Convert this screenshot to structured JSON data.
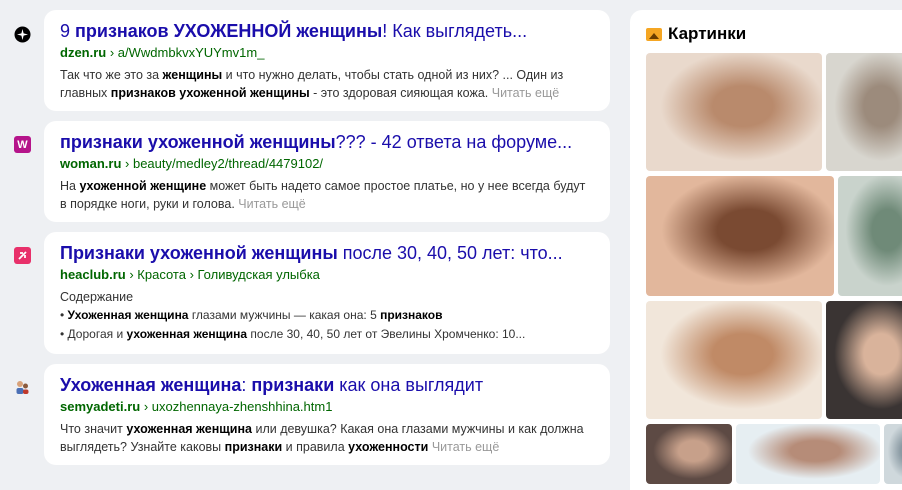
{
  "results": [
    {
      "title_parts": [
        {
          "t": "9 ",
          "b": false
        },
        {
          "t": "признаков УХОЖЕННОЙ женщины",
          "b": true
        },
        {
          "t": "! Как выглядеть...",
          "b": false
        }
      ],
      "domain": "dzen.ru",
      "path": " › a/WwdmbkvxYUYmv1m_",
      "snippet_parts": [
        {
          "t": "Так что же это за ",
          "b": false
        },
        {
          "t": "женщины",
          "b": true
        },
        {
          "t": " и что нужно делать, чтобы стать одной из них? ... Один из главных ",
          "b": false
        },
        {
          "t": "признаков ухоженной женщины",
          "b": true
        },
        {
          "t": " - это здоровая сияющая кожа. ",
          "b": false
        }
      ],
      "more": "Читать ещё",
      "favicon_icon": "dzen-icon",
      "favicon_color": "#000000"
    },
    {
      "title_parts": [
        {
          "t": "признаки ухоженной женщины",
          "b": true
        },
        {
          "t": "??? - 42 ответа на форуме...",
          "b": false
        }
      ],
      "domain": "woman.ru",
      "path": " › beauty/medley2/thread/4479102/",
      "snippet_parts": [
        {
          "t": "На ",
          "b": false
        },
        {
          "t": "ухоженной женщине",
          "b": true
        },
        {
          "t": " может быть надето самое простое платье, но у нее всегда будут в порядке ноги, руки и голова. ",
          "b": false
        }
      ],
      "more": "Читать ещё",
      "favicon_icon": "woman-icon",
      "favicon_letter": "W",
      "favicon_color": "#b5148a"
    },
    {
      "title_parts": [
        {
          "t": "Признаки ухоженной женщины",
          "b": true
        },
        {
          "t": " после 30, 40, 50 лет: что...",
          "b": false
        }
      ],
      "domain": "heaclub.ru",
      "path": " › Красота › Голивудская улыбка",
      "toc_head": "Содержание",
      "toc_items": [
        [
          {
            "t": "Ухоженная женщина",
            "b": true
          },
          {
            "t": " глазами мужчины — какая она: 5 ",
            "b": false
          },
          {
            "t": "признаков",
            "b": true
          }
        ],
        [
          {
            "t": "Дорогая и ",
            "b": false
          },
          {
            "t": "ухоженная женщина",
            "b": true
          },
          {
            "t": " после 30, 40, 50 лет от Эвелины Хромченко: 10...",
            "b": false
          }
        ]
      ],
      "favicon_icon": "heaclub-icon",
      "favicon_color": "#e8306a"
    },
    {
      "title_parts": [
        {
          "t": "Ухоженная женщина",
          "b": true
        },
        {
          "t": ": ",
          "b": false
        },
        {
          "t": "признаки",
          "b": true
        },
        {
          "t": " как она выглядит",
          "b": false
        }
      ],
      "domain": "semyadeti.ru",
      "path": " › uxozhennaya-zhenshhina.htm1",
      "snippet_parts": [
        {
          "t": "Что значит ",
          "b": false
        },
        {
          "t": "ухоженная женщина",
          "b": true
        },
        {
          "t": " или девушка? Какая она глазами мужчины и как должна выглядеть? Узнайте каковы ",
          "b": false
        },
        {
          "t": "признаки",
          "b": true
        },
        {
          "t": " и правила ",
          "b": false
        },
        {
          "t": "ухоженности",
          "b": true
        },
        {
          "t": " ",
          "b": false
        }
      ],
      "more": "Читать ещё",
      "favicon_icon": "family-icon",
      "favicon_color": "#4a6fb5"
    }
  ],
  "images_panel": {
    "title": "Картинки",
    "icon": "pictures-icon",
    "thumb_colors": [
      [
        "#e9d9cc",
        "#b98a6c"
      ],
      [
        "#d8d6cf",
        "#9c8b7c"
      ],
      [
        "#e2b79c",
        "#7a4a32"
      ],
      [
        "#c9d3cc",
        "#6f8a78"
      ],
      [
        "#f1e6da",
        "#c08a66"
      ],
      [
        "#3a3433",
        "#d9b39b"
      ],
      [
        "#5d4a44",
        "#c7a08a"
      ],
      [
        "#e6eef2",
        "#b68c78"
      ],
      [
        "#cfd8dc",
        "#8a9aa3"
      ]
    ]
  }
}
